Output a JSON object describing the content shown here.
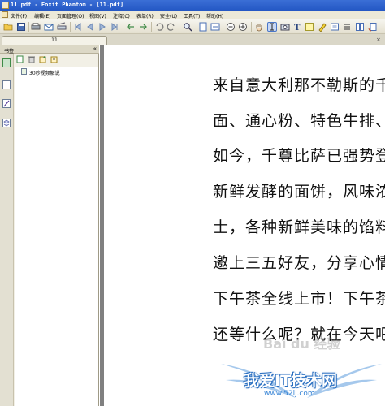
{
  "window": {
    "title": "11.pdf - Foxit Phantom - [11.pdf]"
  },
  "menu": {
    "items": [
      "文件(F)",
      "编辑(E)",
      "页面管理(O)",
      "视图(V)",
      "注释(C)",
      "表单(R)",
      "安全(U)",
      "工具(T)",
      "帮助(H)"
    ]
  },
  "toolbar": {
    "icons": [
      "open-icon",
      "save-icon",
      "print-icon",
      "email-icon",
      "scan-icon",
      "first-page-icon",
      "prev-page-icon",
      "next-page-icon",
      "last-page-icon",
      "go-back-icon",
      "go-forward-icon",
      "undo-icon",
      "redo-icon",
      "zoom-tool-icon",
      "fit-page-icon",
      "fit-width-icon",
      "zoom-out-icon",
      "zoom-in-icon",
      "hand-tool-icon",
      "select-text-icon",
      "snapshot-icon",
      "typewriter-icon",
      "note-icon",
      "highlight-icon",
      "link-icon"
    ]
  },
  "tabs": [
    {
      "label": "11"
    }
  ],
  "nav_pane": {
    "header": "书签",
    "collapse_glyph": "«",
    "bookmarks": [
      {
        "label": "30秒视频解说"
      }
    ]
  },
  "document": {
    "lines": [
      "来自意大利那不勒斯的千",
      "面、通心粉、特色牛排、",
      "如今，千尊比萨已强势登",
      "新鲜发酵的面饼，风味浓",
      "士，各种新鲜美味的馅料",
      "邀上三五好友，分享心情",
      "下午茶全线上市！下午茶",
      "还等什么呢？就在今天吧"
    ]
  },
  "watermark": {
    "brand_text": "Bai du 经验",
    "site_title": "我爱IT技术网",
    "site_url": "www.52ij.com"
  },
  "colors": {
    "title_bar": "#2a5ecb",
    "chrome": "#ece9d8",
    "doc_background": "#808080",
    "watermark_blue": "#5b9bdc"
  }
}
